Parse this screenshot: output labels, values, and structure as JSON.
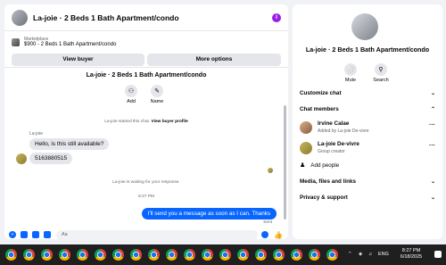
{
  "conversation": {
    "title": "La-joie · 2 Beds 1 Bath Apartment/condo",
    "info_icon": "info-icon"
  },
  "listing": {
    "label": "Marketplace",
    "price_title": "$900 - 2 Beds 1 Bath Apartment/condo",
    "view_buyer_label": "View buyer",
    "more_options_label": "More options"
  },
  "chat": {
    "title": "La-joie · 2 Beds 1 Bath Apartment/condo",
    "add_label": "Add",
    "name_label": "Name",
    "started_prefix": "La-joie started this chat.",
    "started_link": "View buyer profile",
    "sender_name": "La-joie",
    "messages_in": [
      "Hello, is this still available?",
      "5163880515"
    ],
    "waiting": "La-joie is waiting for your response.",
    "time": "8:27 PM",
    "message_out": "I'll send you a message as soon as I can. Thanks",
    "sent_label": "Sent"
  },
  "composer": {
    "placeholder": "Aa"
  },
  "right_panel": {
    "title": "La-joie · 2 Beds 1 Bath Apartment/condo",
    "mute_label": "Mute",
    "search_label": "Search",
    "customize_chat": "Customize chat",
    "chat_members": "Chat members",
    "members": [
      {
        "name": "Irvine Calae",
        "sub": "Added by La-joie De-vivre"
      },
      {
        "name": "La-joie De-vivre",
        "sub": "Group creator"
      }
    ],
    "add_people": "Add people",
    "media_files_links": "Media, files and links",
    "privacy_support": "Privacy & support"
  },
  "taskbar": {
    "language": "ENG",
    "time": "8:27 PM",
    "date": "6/18/2025"
  },
  "colors": {
    "accent": "#0866ff",
    "info": "#9b1de8"
  }
}
